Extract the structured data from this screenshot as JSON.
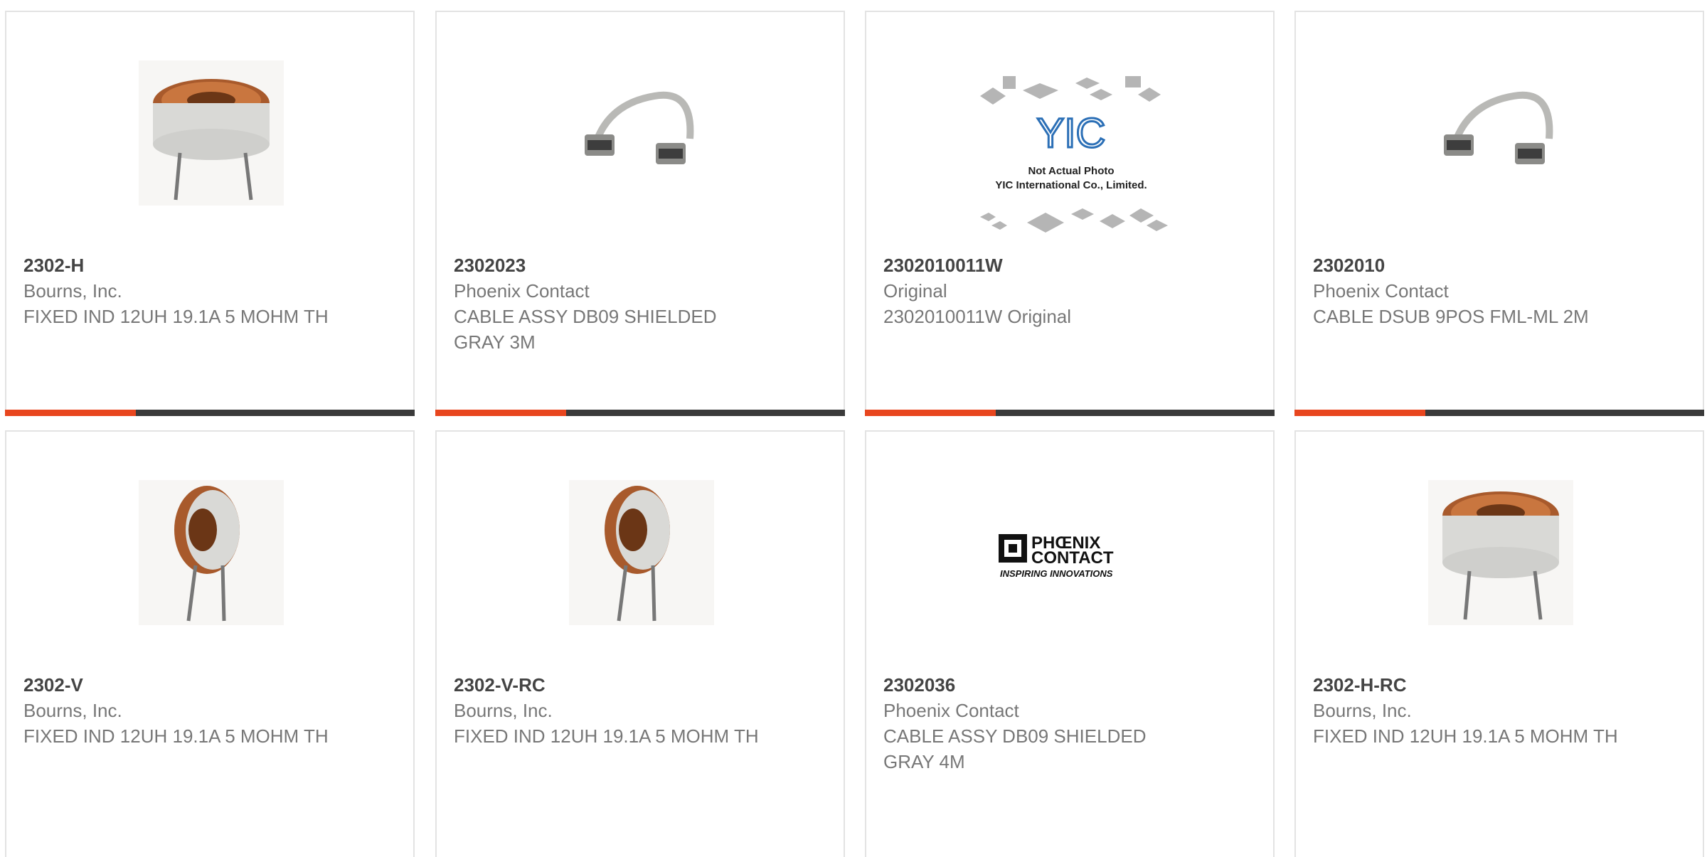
{
  "products": [
    {
      "part_number": "2302-H",
      "manufacturer": "Bourns, Inc.",
      "description": "FIXED IND 12UH 19.1A 5 MOHM TH",
      "image": "toroid-inductor-horizontal-icon"
    },
    {
      "part_number": "2302023",
      "manufacturer": "Phoenix Contact",
      "description": "CABLE ASSY DB09 SHIELDED GRAY 3M",
      "image": "dsub-cable-icon"
    },
    {
      "part_number": "2302010011W",
      "manufacturer": "Original",
      "description": "2302010011W Original",
      "image": "placeholder-photo-icon",
      "placeholder_logo_text": "YIC",
      "placeholder_caption_1": "Not Actual Photo",
      "placeholder_caption_2": "YIC International Co., Limited."
    },
    {
      "part_number": "2302010",
      "manufacturer": "Phoenix Contact",
      "description": "CABLE DSUB 9POS FML-ML 2M",
      "image": "dsub-cable-icon"
    },
    {
      "part_number": "2302-V",
      "manufacturer": "Bourns, Inc.",
      "description": "FIXED IND 12UH 19.1A 5 MOHM TH",
      "image": "toroid-inductor-vertical-icon"
    },
    {
      "part_number": "2302-V-RC",
      "manufacturer": "Bourns, Inc.",
      "description": "FIXED IND 12UH 19.1A 5 MOHM TH",
      "image": "toroid-inductor-vertical-icon"
    },
    {
      "part_number": "2302036",
      "manufacturer": "Phoenix Contact",
      "description": "CABLE ASSY DB09 SHIELDED GRAY 4M",
      "image": "phoenix-contact-logo-icon",
      "logo_text_1": "PHŒNIX",
      "logo_text_2": "CONTACT",
      "logo_tagline": "INSPIRING INNOVATIONS"
    },
    {
      "part_number": "2302-H-RC",
      "manufacturer": "Bourns, Inc.",
      "description": "FIXED IND 12UH 19.1A 5 MOHM TH",
      "image": "toroid-inductor-horizontal-icon"
    }
  ],
  "colors": {
    "accent": "#e8461e",
    "bar": "#3a3a3a",
    "border": "#e3e3e3",
    "title": "#444444",
    "text": "#777777"
  }
}
